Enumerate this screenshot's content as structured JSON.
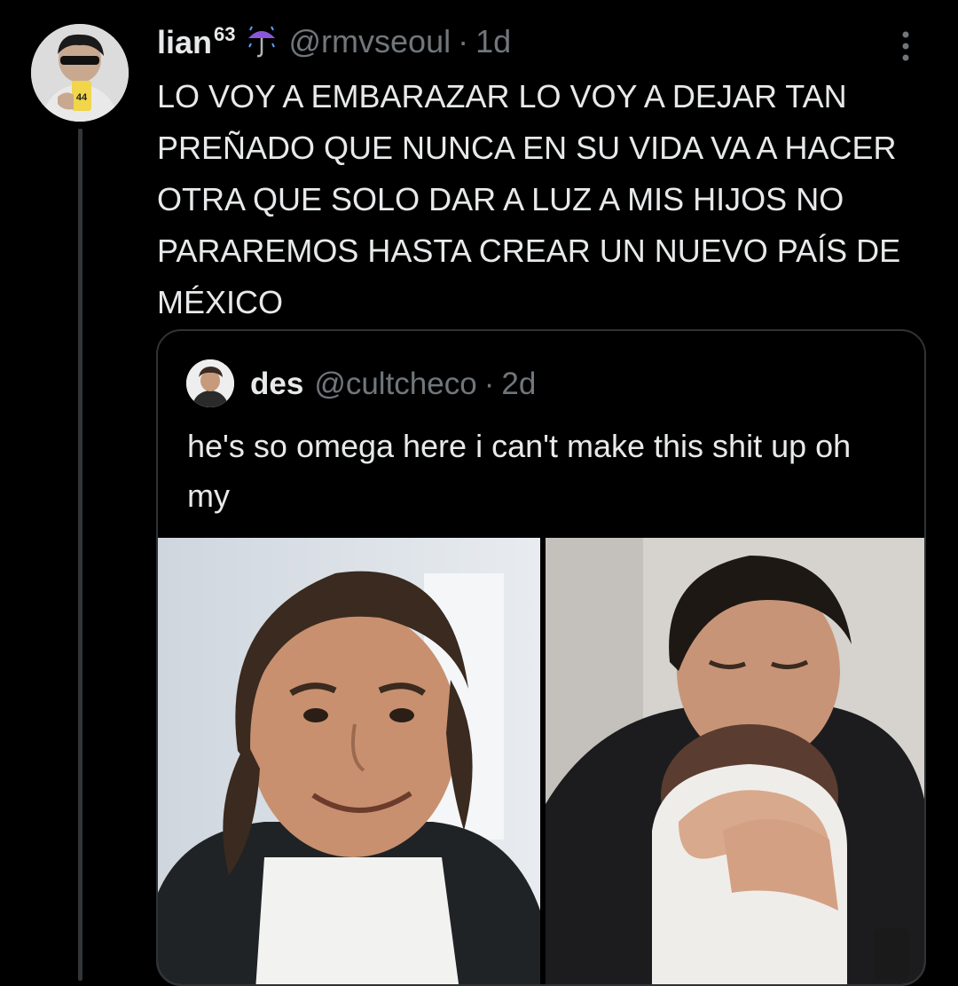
{
  "tweet": {
    "author": {
      "name": "lian",
      "name_superscript": "63",
      "handle": "@rmvseoul",
      "emoji": "umbrella-with-rain-icon"
    },
    "separator": "·",
    "age": "1d",
    "text": "LO VOY A EMBARAZAR LO VOY A DEJAR TAN PREÑADO QUE NUNCA EN SU VIDA VA A HACER OTRA QUE SOLO DAR A LUZ A MIS HIJOS NO PARAREMOS HASTA CREAR UN NUEVO PAÍS DE MÉXICO",
    "avatar_badge": "44"
  },
  "quoted": {
    "author": {
      "name": "des",
      "handle": "@cultcheco"
    },
    "separator": "·",
    "age": "2d",
    "text": "he's so omega here i can't make this shit up oh my",
    "media": [
      {
        "icon": "photo-smiling-man"
      },
      {
        "icon": "photo-man-holding-baby"
      }
    ]
  },
  "colors": {
    "background": "#000000",
    "text_primary": "#e7e9ea",
    "text_secondary": "#71767b",
    "border": "#2f3336",
    "thread_line": "#333639"
  }
}
